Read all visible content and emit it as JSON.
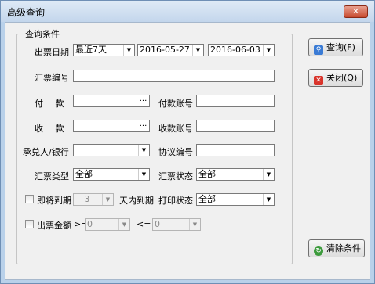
{
  "window": {
    "title": "高级查询",
    "close_glyph": "✕"
  },
  "group": {
    "title": "查询条件"
  },
  "labels": {
    "issue_date": "出票日期",
    "bill_no": "汇票编号",
    "payer": "付 款 人",
    "payer_account": "付款账号",
    "payee": "收 款 人",
    "payee_account": "收款账号",
    "acceptor": "承兑人/银行",
    "agreement_no": "协议编号",
    "bill_type": "汇票类型",
    "bill_status": "汇票状态",
    "expiring": "即将到期",
    "days_suffix": "天内到期",
    "print_status": "打印状态",
    "amount": "出票金额",
    "gte": ">=",
    "lte": "<="
  },
  "fields": {
    "date_range": "最近7天",
    "date_from": "2016-05-27",
    "date_to": "2016-06-03",
    "bill_no": "",
    "payer": "",
    "payer_account": "",
    "payee": "",
    "payee_account": "",
    "acceptor": "",
    "agreement_no": "",
    "bill_type": "全部",
    "bill_status": "全部",
    "days": "3",
    "print_status": "全部",
    "amount_min": "0",
    "amount_max": "0",
    "browse_glyph": "...",
    "dropdown_glyph": "▼"
  },
  "checkboxes": {
    "expiring": false,
    "amount": false
  },
  "buttons": {
    "query": "查询(F)",
    "close": "关闭(Q)",
    "clear": "清除条件"
  },
  "icons": {
    "query": "search-icon",
    "close": "close-icon",
    "clear": "refresh-icon"
  },
  "colors": {
    "accent": "#3a7bd5",
    "close_red": "#d9342b",
    "clear_green": "#3c9b3c"
  }
}
